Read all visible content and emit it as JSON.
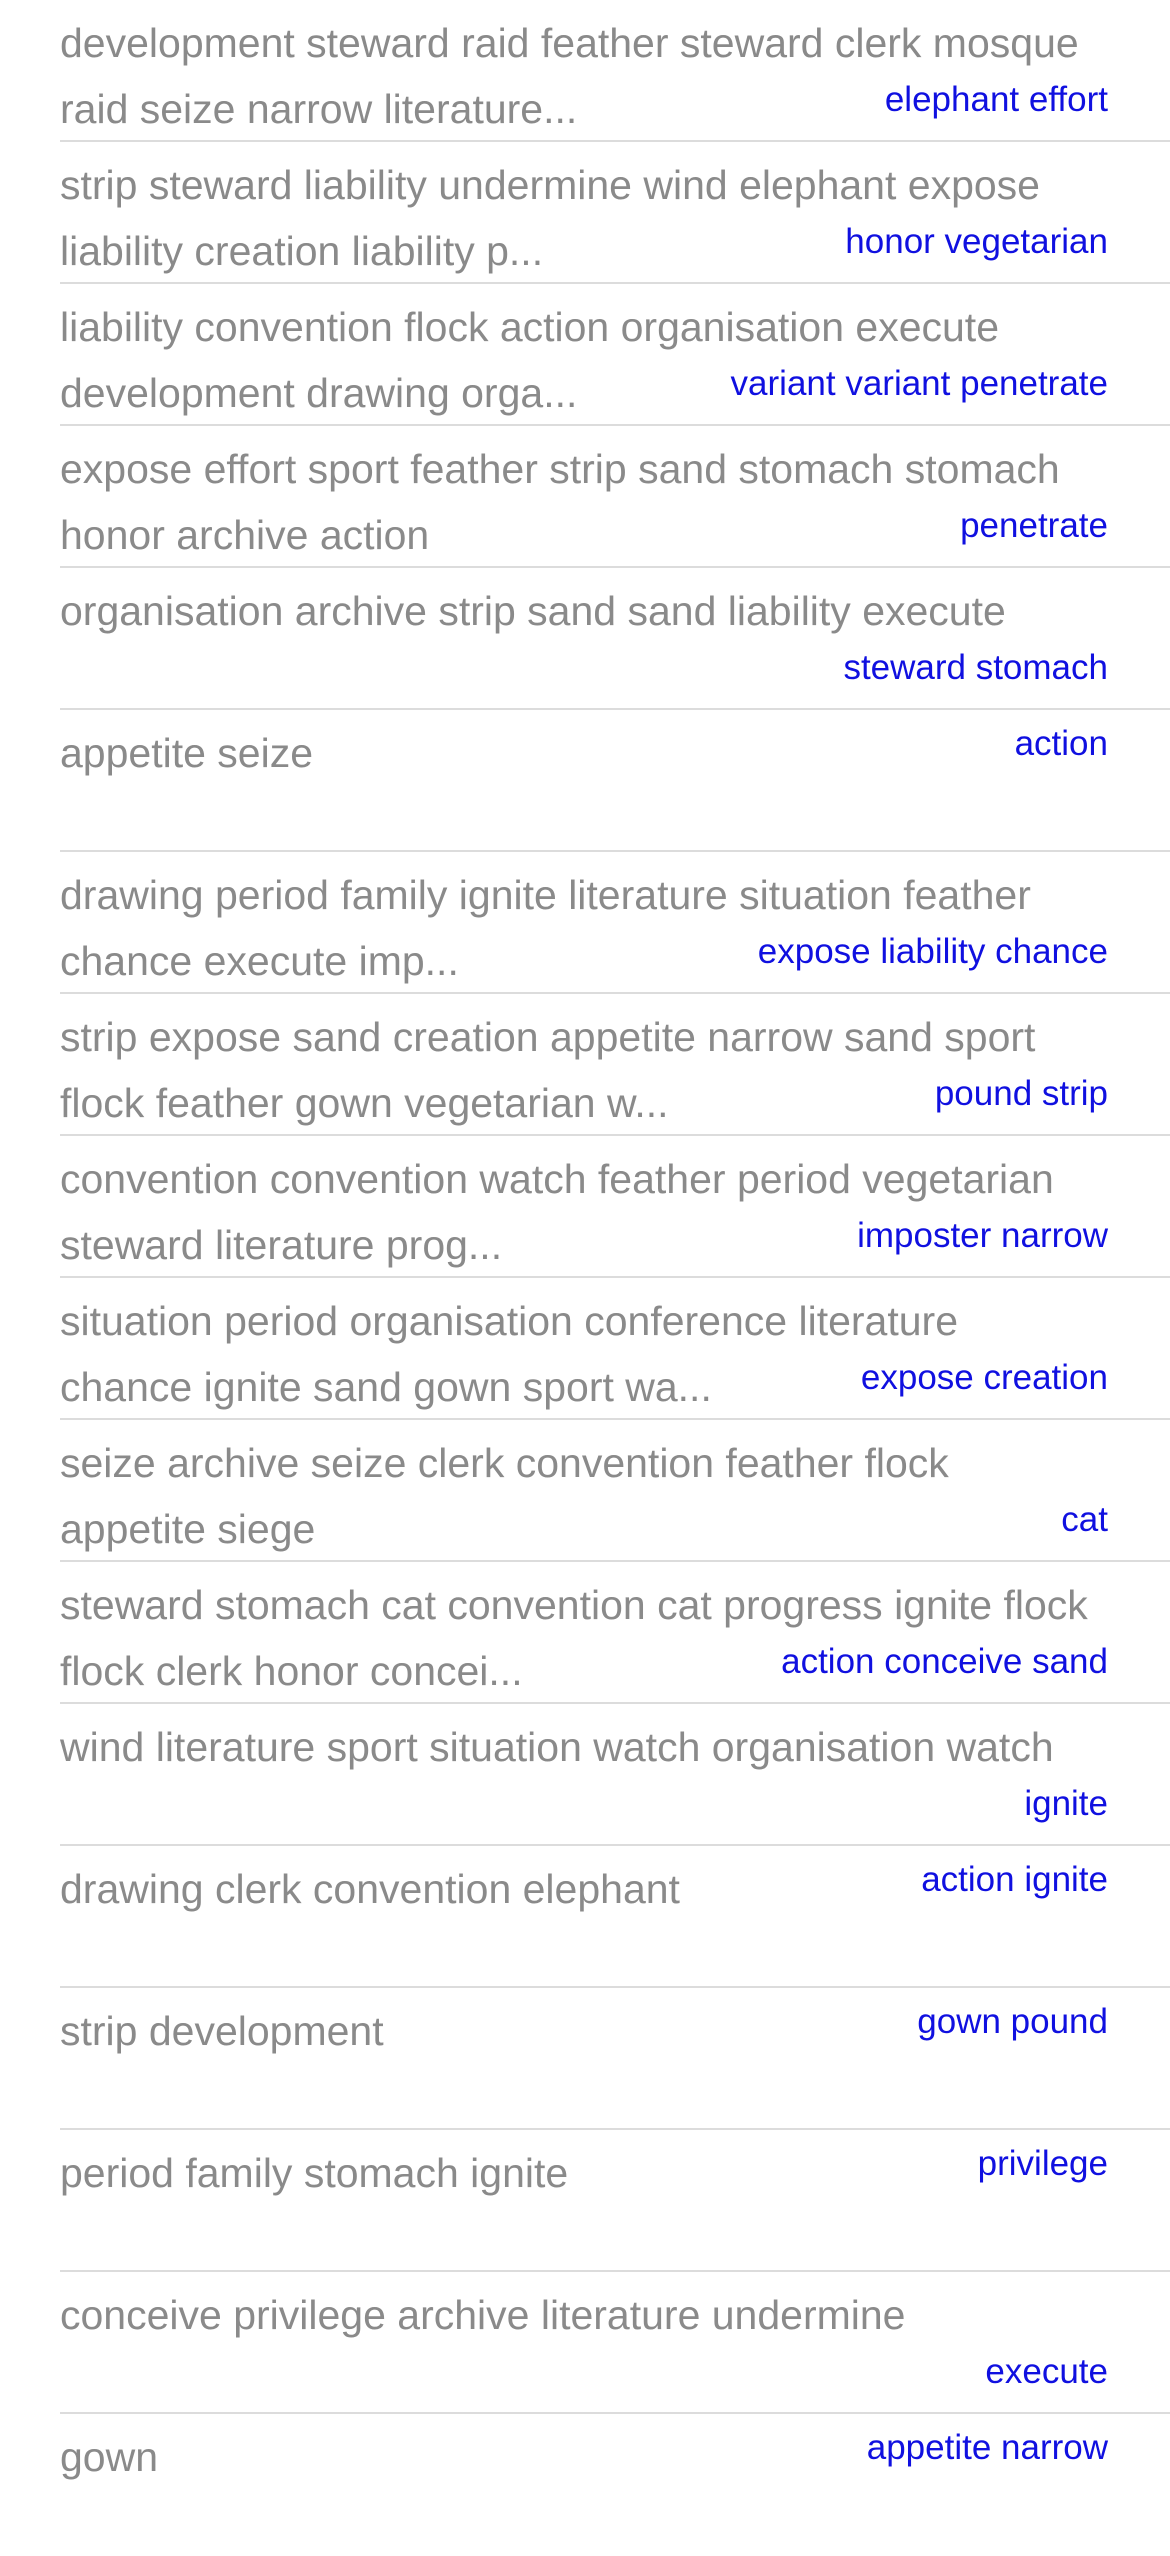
{
  "list": {
    "rows": [
      {
        "title": "development steward raid feather steward clerk mosque raid seize narrow literature...",
        "detail": "elephant effort"
      },
      {
        "title": "strip steward liability undermine wind elephant expose liability creation liability p...",
        "detail": "honor vegetarian"
      },
      {
        "title": "liability convention flock action organisation execute development drawing orga...",
        "detail": "variant variant penetrate"
      },
      {
        "title": "expose effort sport feather strip sand stomach stomach honor archive action",
        "detail": "penetrate"
      },
      {
        "title": "organisation archive strip sand sand liability execute",
        "detail": "steward stomach"
      },
      {
        "title": "appetite seize",
        "detail": "action"
      },
      {
        "title": "drawing period family ignite literature situation feather chance execute imp...",
        "detail": "expose liability chance"
      },
      {
        "title": "strip expose sand creation appetite narrow sand sport flock feather gown vegetarian w...",
        "detail": "pound strip"
      },
      {
        "title": "convention convention watch feather period vegetarian steward literature prog...",
        "detail": "imposter narrow"
      },
      {
        "title": "situation period organisation conference literature chance ignite sand gown sport wa...",
        "detail": "expose creation"
      },
      {
        "title": "seize archive seize clerk convention feather flock appetite siege",
        "detail": "cat"
      },
      {
        "title": "steward stomach cat convention cat progress ignite flock flock clerk honor concei...",
        "detail": "action conceive sand"
      },
      {
        "title": "wind literature sport situation watch organisation watch",
        "detail": "ignite"
      },
      {
        "title": "drawing clerk convention elephant",
        "detail": "action ignite"
      },
      {
        "title": "strip development",
        "detail": "gown pound"
      },
      {
        "title": "period family stomach ignite",
        "detail": "privilege"
      },
      {
        "title": "conceive privilege archive literature undermine",
        "detail": "execute"
      },
      {
        "title": "gown",
        "detail": "appetite narrow"
      }
    ]
  },
  "colors": {
    "title_text": "#8a8a8a",
    "detail_text": "#1010e0",
    "separator": "#dcdcdc",
    "background": "#ffffff"
  }
}
